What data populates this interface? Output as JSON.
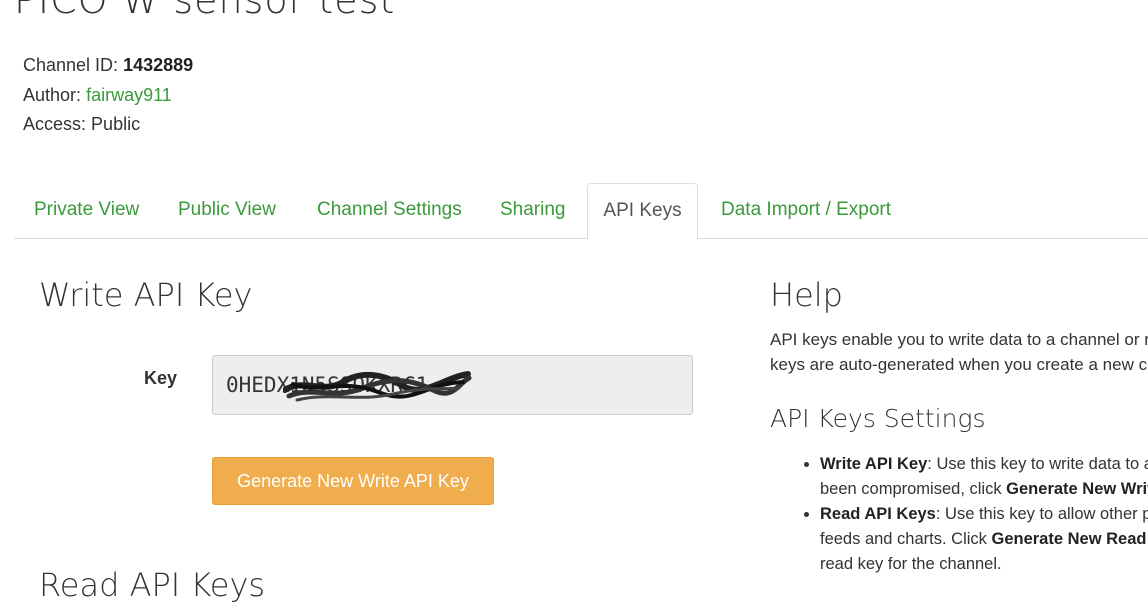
{
  "channel": {
    "title": "PICO W sensor test",
    "id_label": "Channel ID:",
    "id_value": "1432889",
    "author_label": "Author:",
    "author_value": "fairway911",
    "access_label": "Access:",
    "access_value": "Public"
  },
  "tabs": [
    {
      "label": "Private View"
    },
    {
      "label": "Public View"
    },
    {
      "label": "Channel Settings"
    },
    {
      "label": "Sharing"
    },
    {
      "label": "API Keys",
      "active": true
    },
    {
      "label": "Data Import / Export"
    }
  ],
  "write_key": {
    "heading": "Write API Key",
    "key_label": "Key",
    "key_value": "0HEDX1N5SSOKXRC1",
    "generate_button": "Generate New Write API Key"
  },
  "read_keys": {
    "heading": "Read API Keys"
  },
  "help": {
    "heading": "Help",
    "intro_line1": "API keys enable you to write data to a channel or re",
    "intro_line2": "keys are auto-generated when you create a new ch",
    "settings_heading": "API Keys Settings",
    "items": [
      {
        "term": "Write API Key",
        "text1": ": Use this key to write data to a",
        "text2_pre": "been compromised, click ",
        "text2_bold": "Generate New Writ"
      },
      {
        "term": "Read API Keys",
        "text1": ": Use this key to allow other pe",
        "text2": "feeds and charts. Click ",
        "text2_bold": "Generate New Read A",
        "text3": "read key for the channel."
      }
    ]
  },
  "colors": {
    "link_green": "#3a9a3a",
    "button_orange": "#efad4d"
  }
}
